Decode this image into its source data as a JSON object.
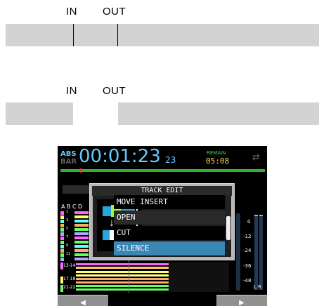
{
  "diagram": {
    "top": {
      "in_label": "IN",
      "out_label": "OUT"
    },
    "bottom": {
      "in_label": "IN",
      "out_label": "OUT"
    }
  },
  "screen": {
    "abs_label": "ABS",
    "bar_label": "BAR",
    "time": "00:01:23",
    "frames": "23",
    "remain_label": "REMAIN",
    "remain_time": "05:08",
    "track_letters": [
      "A",
      "B",
      "C",
      "D"
    ],
    "track_numbers": [
      "1",
      "3",
      "5",
      "7",
      "9",
      "11",
      "13-14",
      "17-18",
      "21-22"
    ],
    "dialog": {
      "title": "TRACK EDIT",
      "items": [
        "MOVE INSERT",
        "OPEN",
        "CUT",
        "SILENCE"
      ],
      "selected_index": 3
    },
    "meter_scale": [
      "0",
      "-12",
      "-24",
      "-36",
      "-48"
    ],
    "meter_lr": "L R",
    "left_arrow": "◀",
    "right_arrow": "▶"
  }
}
